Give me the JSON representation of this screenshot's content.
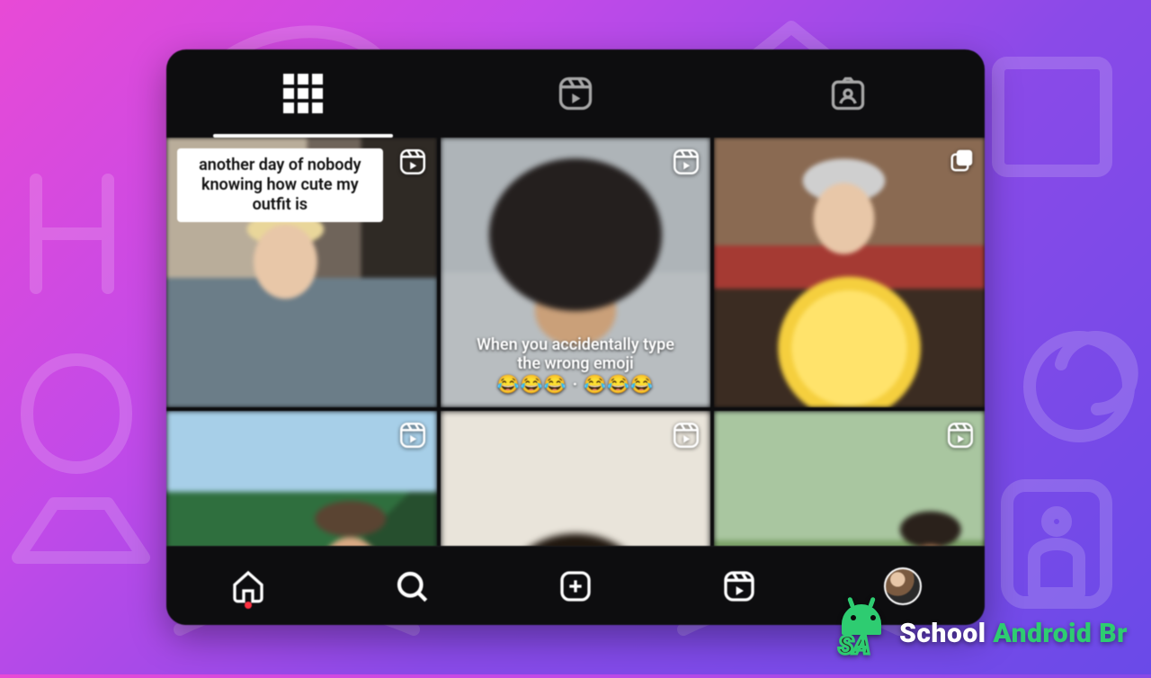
{
  "tabs": {
    "grid": "grid",
    "reels": "reels",
    "tagged": "tagged"
  },
  "posts": [
    {
      "badge": "reels",
      "caption_top": "another day of nobody knowing how cute my outfit is"
    },
    {
      "badge": "reels",
      "caption_bottom": "When you accidentally type the wrong emoji",
      "emoji_row": "😂😂😂 · 😂😂😂"
    },
    {
      "badge": "carousel"
    },
    {
      "badge": "reels"
    },
    {
      "badge": "reels"
    },
    {
      "badge": "reels"
    }
  ],
  "nav": {
    "home": "home",
    "search": "search",
    "create": "create",
    "reels": "reels",
    "profile": "profile",
    "home_notification": true
  },
  "watermark": {
    "badge": "SA",
    "part1": "School ",
    "part2": "Android Br"
  }
}
